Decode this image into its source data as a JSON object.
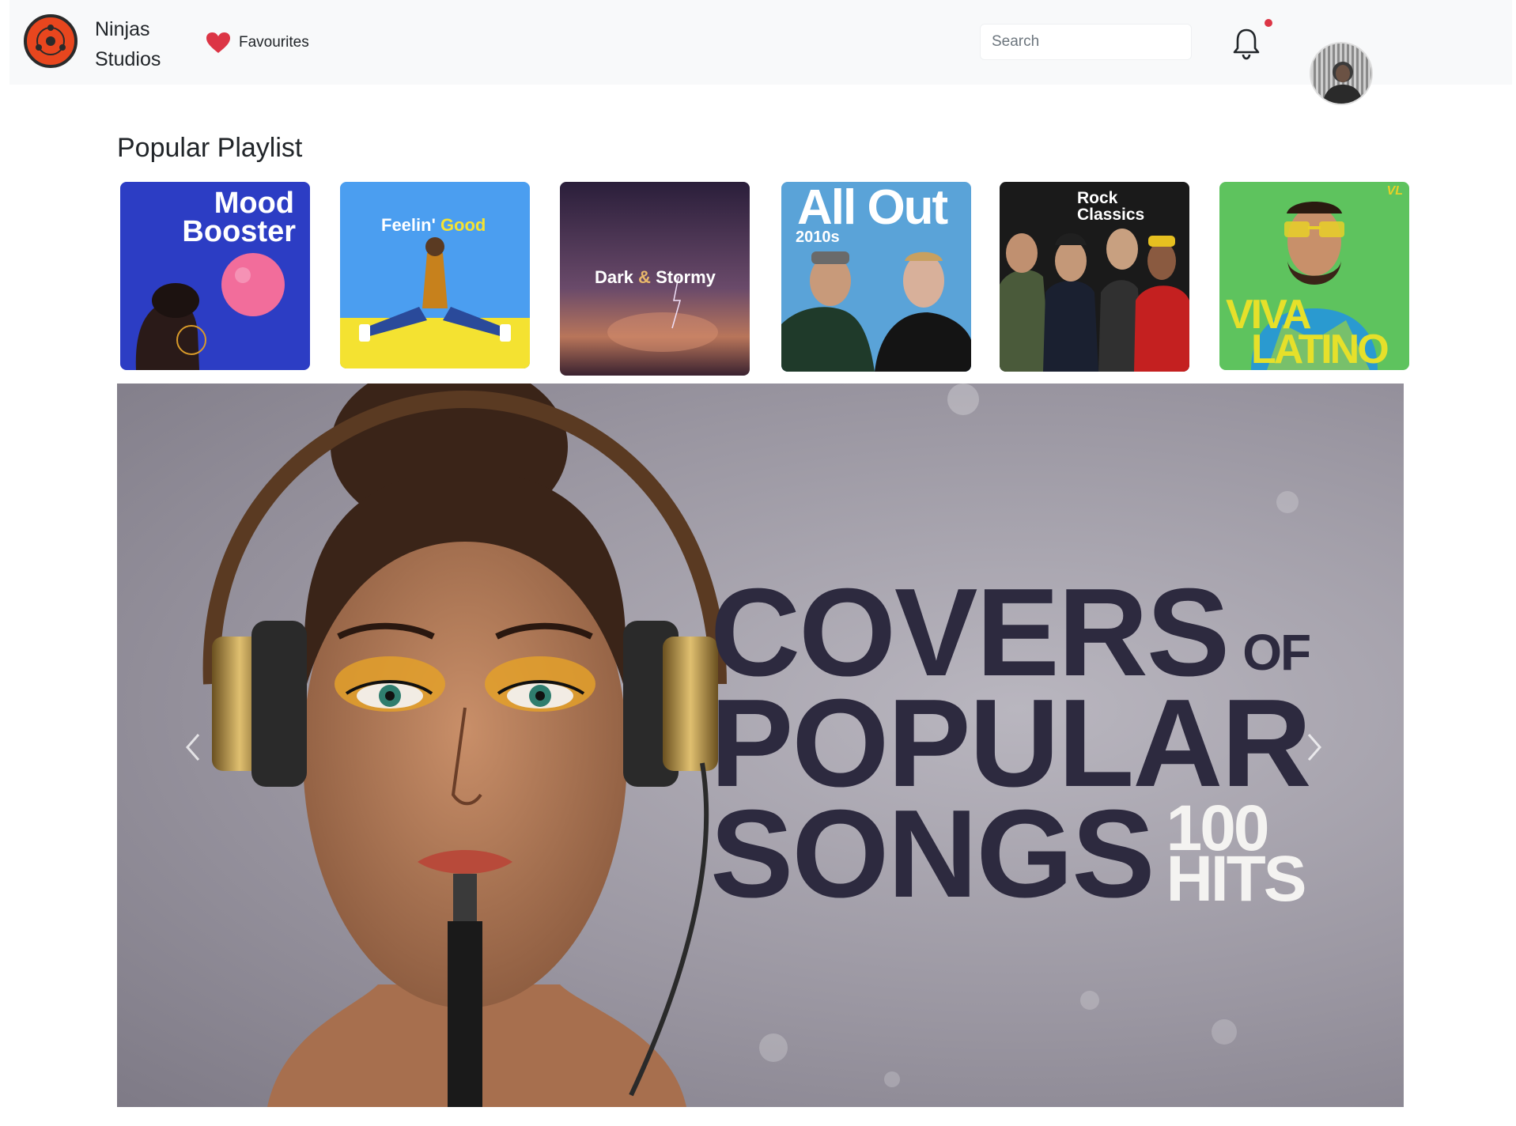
{
  "brand": {
    "name": "Ninjas Studios"
  },
  "nav": {
    "favourites_label": "Favourites"
  },
  "search": {
    "placeholder": "Search",
    "value": ""
  },
  "notifications": {
    "has_unread": true
  },
  "section": {
    "title": "Popular Playlist"
  },
  "playlists": [
    {
      "title": "Mood Booster",
      "line1": "Mood",
      "line2": "Booster"
    },
    {
      "title": "Feelin' Good",
      "part1": "Feelin'",
      "part2": "Good"
    },
    {
      "title": "Dark & Stormy",
      "part1": "Dark",
      "amp": "&",
      "part2": "Stormy"
    },
    {
      "title": "All Out 2010s",
      "line1": "All Out",
      "line2": "2010s"
    },
    {
      "title": "Rock Classics",
      "line1": "Rock Classics"
    },
    {
      "title": "VIVA LATINO",
      "line1": "VIVA",
      "line2": "LATINO",
      "badge": "VL"
    }
  ],
  "hero": {
    "line1": "COVERS",
    "of": "OF",
    "line2": "POPULAR",
    "line3": "SONGS",
    "count": "100",
    "hits": "HITS"
  },
  "colors": {
    "nav_bg": "#f8f9fa",
    "heart": "#dc3545",
    "notification_dot": "#dc3545",
    "hero_text": "#2d2a3f"
  },
  "icons": {
    "logo": "sharingan-logo-icon",
    "favourites": "heart-icon",
    "notifications": "bell-icon",
    "prev": "chevron-left-icon",
    "next": "chevron-right-icon"
  }
}
